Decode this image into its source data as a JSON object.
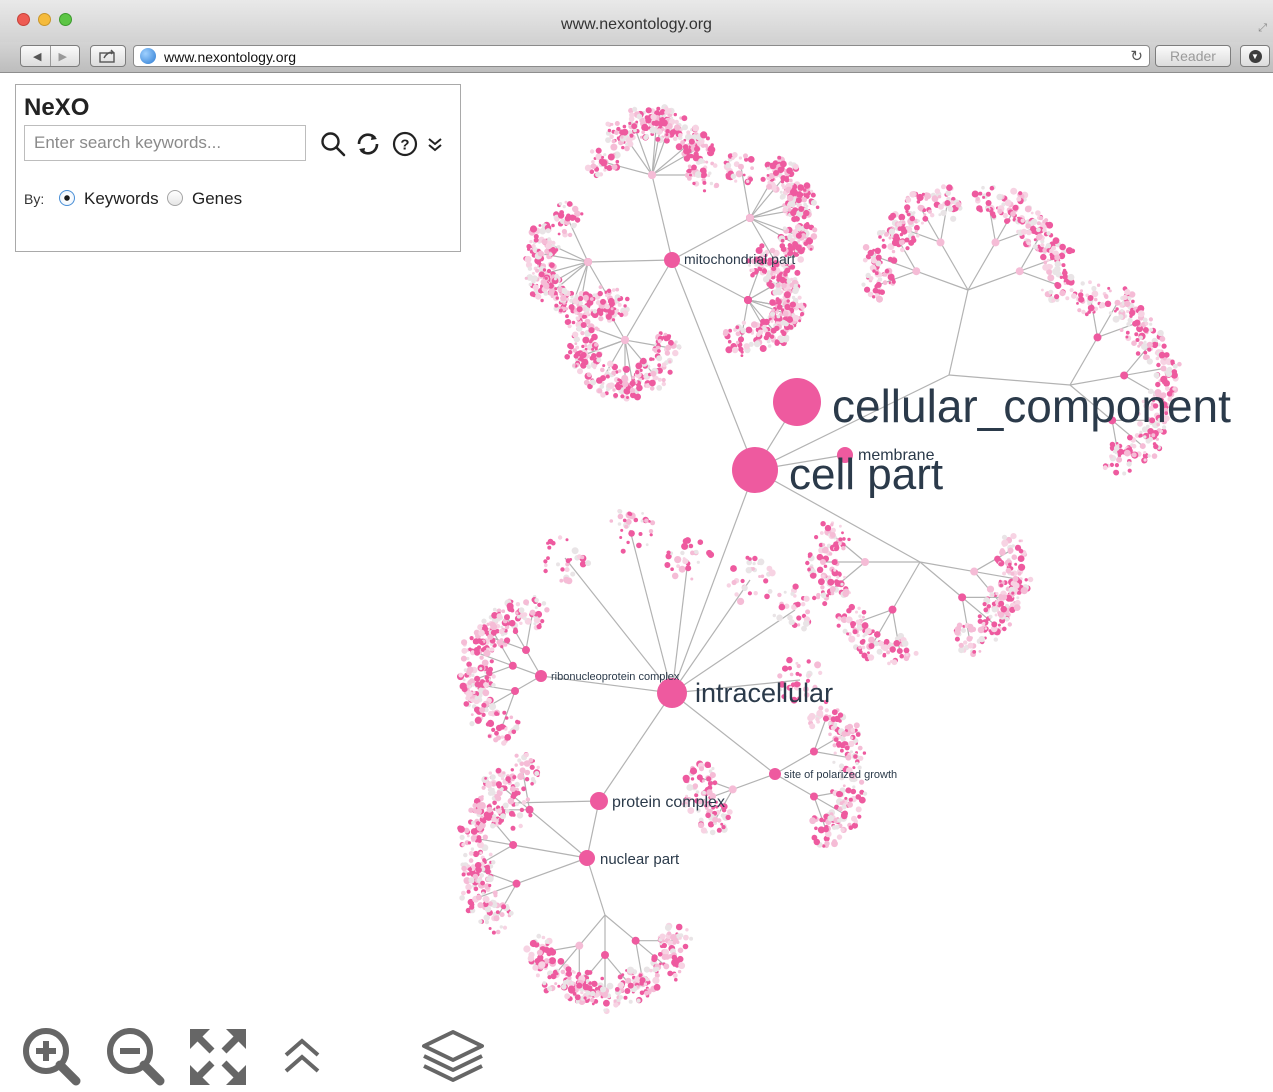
{
  "window": {
    "title": "www.nexontology.org"
  },
  "toolbar": {
    "url": "www.nexontology.org",
    "reader_label": "Reader"
  },
  "panel": {
    "title": "NeXO",
    "search_placeholder": "Enter search keywords...",
    "by_label": "By:",
    "options": [
      {
        "label": "Keywords",
        "selected": true
      },
      {
        "label": "Genes",
        "selected": false
      }
    ]
  },
  "graph": {
    "labels": {
      "cellular_component": "cellular_component",
      "cell_part": "cell part",
      "membrane": "membrane",
      "mitochondrial_part": "mitochondrial part",
      "intracellular": "intracellular",
      "ribonucleoprotein_complex": "ribonucleoprotein complex",
      "site_of_polarized_growth": "site of polarized growth",
      "protein_complex": "protein complex",
      "nuclear_part": "nuclear part"
    },
    "colors": {
      "node": "#ee5a9f",
      "node_light": "#f5bcd6",
      "edge": "#b3b3b3"
    }
  },
  "controls": {
    "icons": [
      "zoom-in-icon",
      "zoom-out-icon",
      "fit-to-screen-icon",
      "collapse-up-icon",
      "layers-icon"
    ]
  }
}
